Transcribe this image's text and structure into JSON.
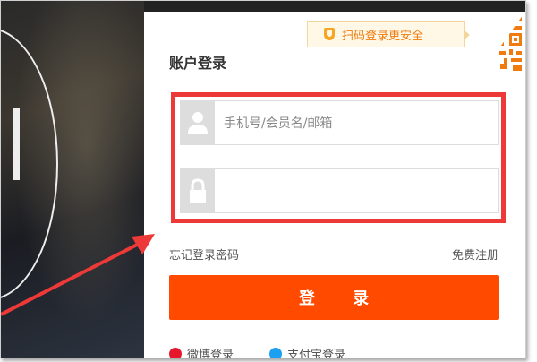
{
  "login": {
    "title": "账户登录",
    "qr_tip": "扫码登录更安全",
    "username_placeholder": "手机号/会员名/邮箱",
    "password_value": "",
    "forgot_password": "忘记登录密码",
    "register": "免费注册",
    "submit": "登 录",
    "alt_logins": [
      "微博登录",
      "支付宝登录"
    ]
  },
  "colors": {
    "accent": "#ff4a00",
    "highlight_box": "#ee3939",
    "tip_text": "#f07b0f"
  }
}
